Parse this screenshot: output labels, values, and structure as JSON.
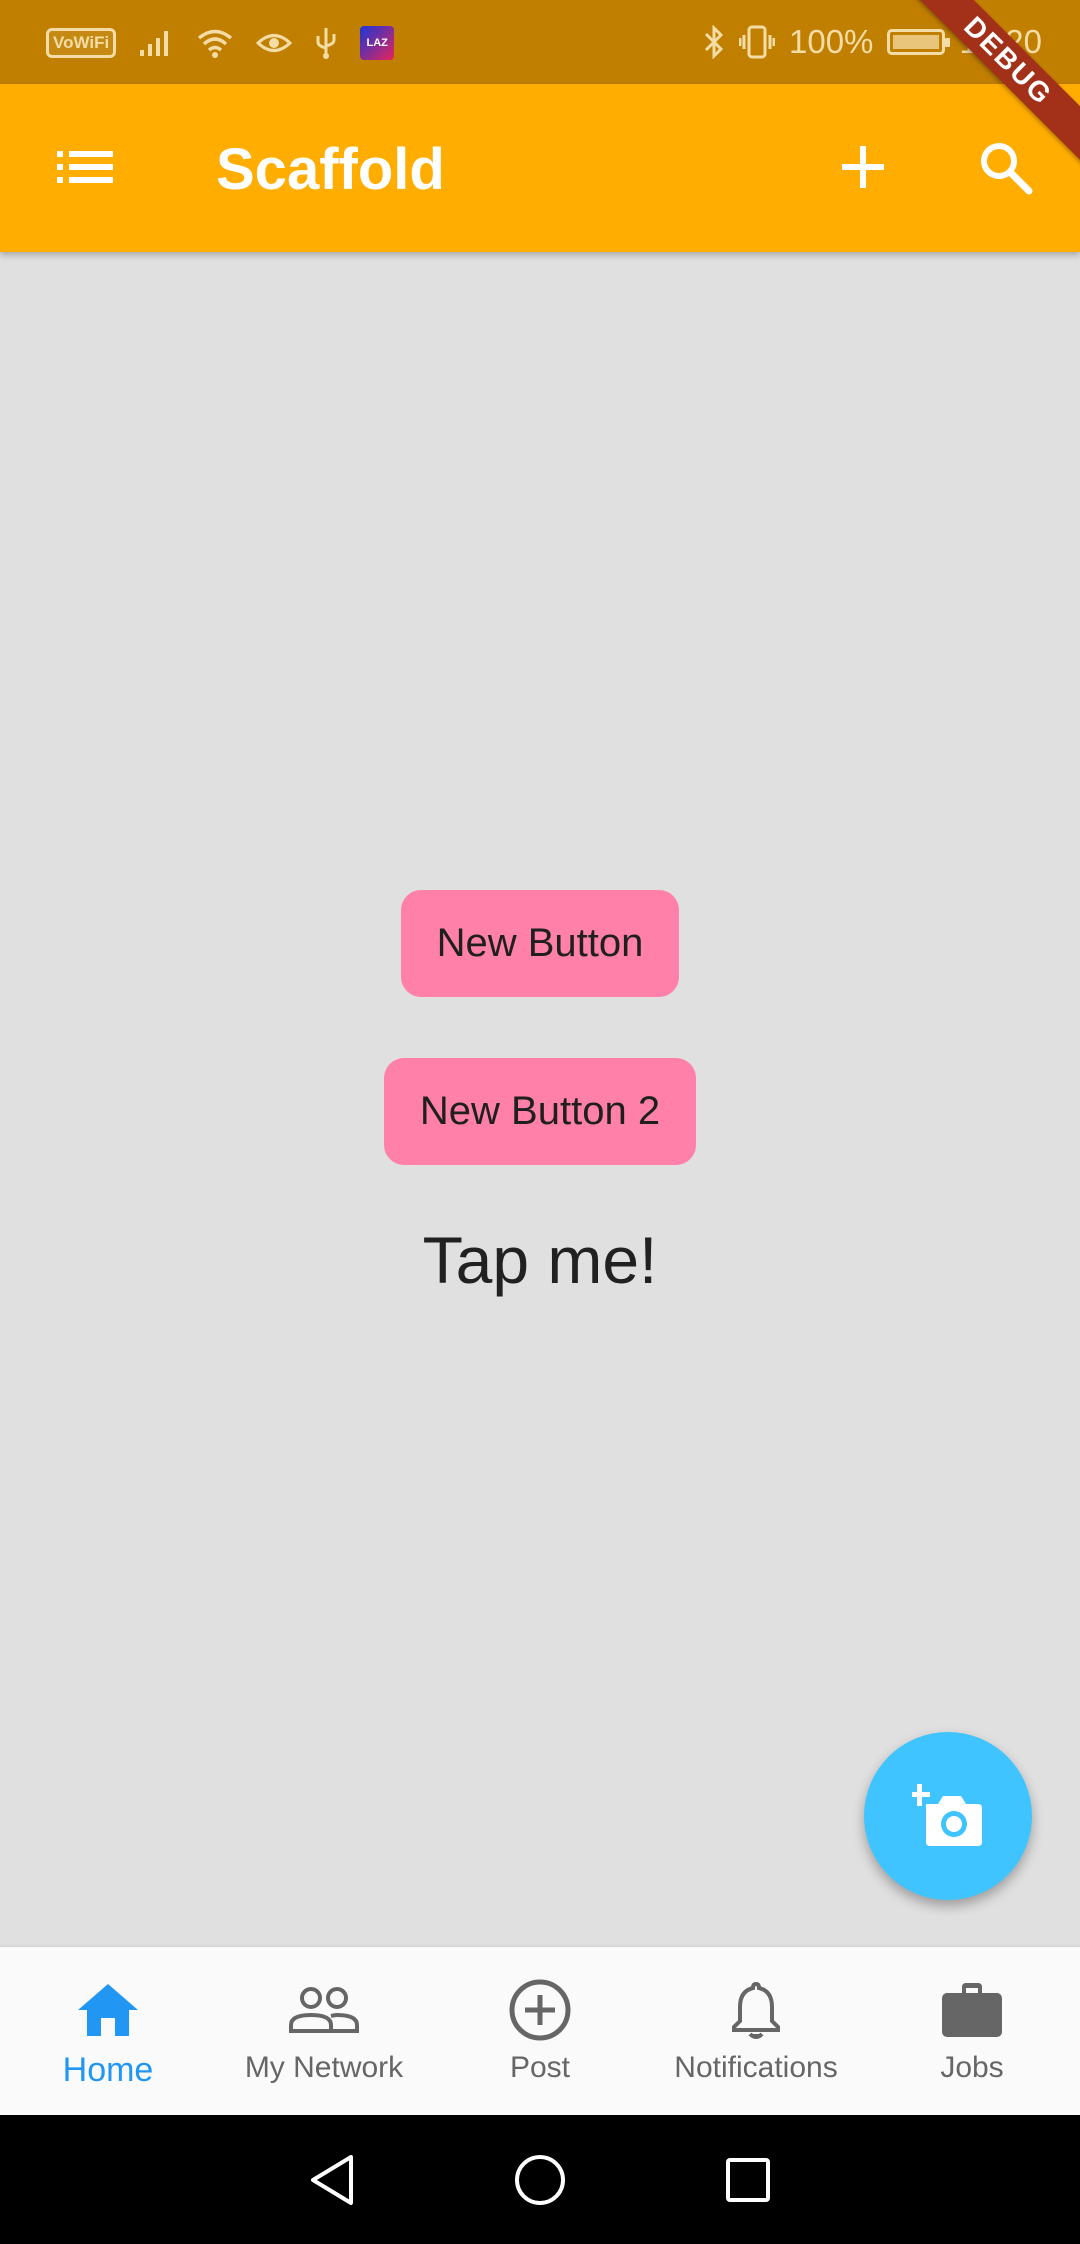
{
  "status_bar": {
    "vowifi": "VoWiFi",
    "lazada_badge": "LAZ",
    "battery_percent": "100%",
    "time": "10:20"
  },
  "debug_banner": "DEBUG",
  "app_bar": {
    "title": "Scaffold",
    "menu_icon": "list-icon",
    "add_icon": "add-icon",
    "search_icon": "search-icon"
  },
  "body": {
    "button1_label": "New Button",
    "button2_label": "New Button 2",
    "tap_text": "Tap me!"
  },
  "fab": {
    "icon": "add-a-photo-icon"
  },
  "bottom_nav": {
    "items": [
      {
        "label": "Home",
        "icon": "home-icon",
        "active": true
      },
      {
        "label": "My Network",
        "icon": "people-icon",
        "active": false
      },
      {
        "label": "Post",
        "icon": "add-circle-icon",
        "active": false
      },
      {
        "label": "Notifications",
        "icon": "bell-icon",
        "active": false
      },
      {
        "label": "Jobs",
        "icon": "briefcase-icon",
        "active": false
      }
    ]
  },
  "colors": {
    "status_bar": "#c17f00",
    "app_bar": "#ffad00",
    "button": "#ff80a8",
    "fab": "#40c4ff",
    "active_nav": "#2196f3"
  }
}
